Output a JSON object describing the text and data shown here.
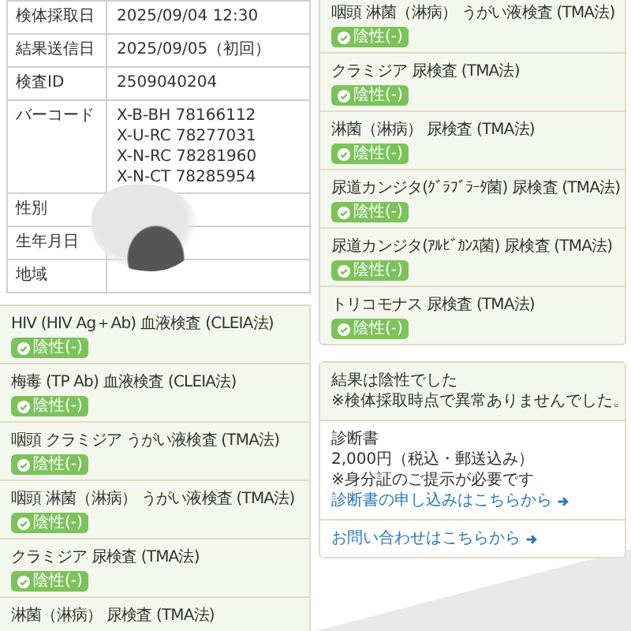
{
  "info_table": {
    "rows": [
      {
        "label": "検体採取日",
        "values": [
          "2025/09/04  12:30"
        ]
      },
      {
        "label": "結果送信日",
        "values": [
          "2025/09/05（初回）"
        ]
      },
      {
        "label": "検査ID",
        "values": [
          "2509040204"
        ]
      },
      {
        "label": "バーコード",
        "values": [
          "X-B-BH  78166112",
          "X-U-RC  78277031",
          "X-N-RC  78281960",
          "X-N-CT  78285954"
        ]
      },
      {
        "label": "性別",
        "values": []
      },
      {
        "label": "生年月日",
        "values": []
      },
      {
        "label": "地域",
        "values": []
      }
    ]
  },
  "results_left": [
    {
      "test": "HIV (HIV Ag＋Ab) 血液検査 (CLEIA法)",
      "result": "陰性(-)"
    },
    {
      "test": "梅毒 (TP Ab) 血液検査 (CLEIA法)",
      "result": "陰性(-)"
    },
    {
      "test": "咽頭 クラミジア うがい液検査 (TMA法)",
      "result": "陰性(-)"
    },
    {
      "test": "咽頭 淋菌（淋病） うがい液検査 (TMA法)",
      "result": "陰性(-)"
    },
    {
      "test": "クラミジア 尿検査 (TMA法)",
      "result": "陰性(-)"
    },
    {
      "test": "淋菌（淋病） 尿検査 (TMA法)"
    }
  ],
  "results_right": [
    {
      "test": "咽頭 淋菌（淋病） うがい液検査 (TMA法)",
      "result": "陰性(-)"
    },
    {
      "test": "クラミジア 尿検査 (TMA法)",
      "result": "陰性(-)"
    },
    {
      "test": "淋菌（淋病） 尿検査 (TMA法)",
      "result": "陰性(-)"
    },
    {
      "test": "尿道カンジタ(ｸﾞﾗﾌﾞﾗｰﾀ菌) 尿検査 (TMA法)",
      "result": "陰性(-)"
    },
    {
      "test": "尿道カンジタ(ｱﾙﾋﾞｶﾝｽ菌) 尿検査 (TMA法)",
      "result": "陰性(-)"
    },
    {
      "test": "トリコモナス 尿検査 (TMA法)",
      "result": "陰性(-)"
    }
  ],
  "summary": {
    "lines": [
      "結果は陰性でした",
      "※検体採取時点で異常ありませんでした。"
    ],
    "certificate": {
      "title": "診断書",
      "price": "2,000円（税込・郵送込み）",
      "note": "※身分証のご提示が必要です",
      "link": "診断書の申し込みはこちらから"
    },
    "contact_link": "お問い合わせはこちらから"
  }
}
